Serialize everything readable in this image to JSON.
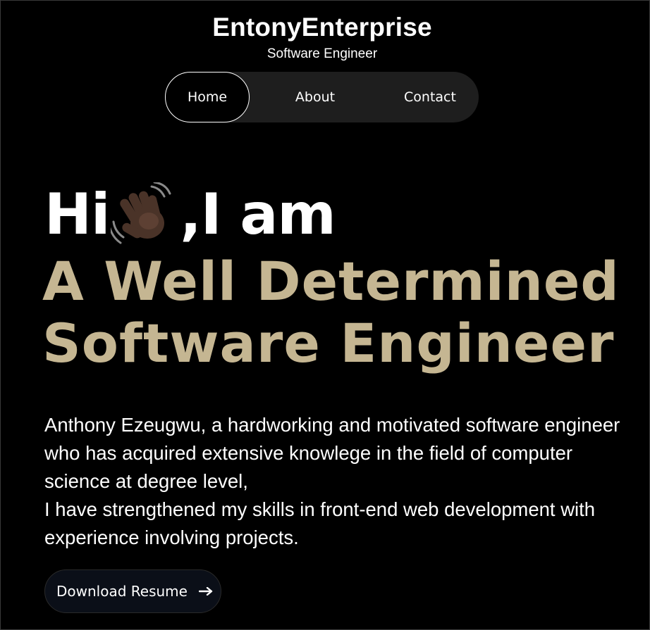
{
  "header": {
    "brand": "EntonyEnterprise",
    "subtitle": "Software Engineer"
  },
  "nav": {
    "items": [
      {
        "label": "Home",
        "active": true
      },
      {
        "label": "About",
        "active": false
      },
      {
        "label": "Contact",
        "active": false
      }
    ]
  },
  "hero": {
    "greeting_before": "Hi",
    "greeting_icon": "waving-hand-icon",
    "greeting_after": ",I am",
    "title_line_1": "A Well Determined",
    "title_line_2": "Software Engineer"
  },
  "bio": {
    "paragraph_1": "Anthony Ezeugwu, a hardworking and motivated software engineer who has acquired extensive knowlege in the field of computer science at degree level,",
    "paragraph_2": "I have strengthened my skills in front-end web development with experience involving projects."
  },
  "cta": {
    "download_label": "Download Resume",
    "icon": "arrow-right-icon"
  },
  "colors": {
    "background": "#000000",
    "accent": "#c5b692",
    "nav_bg": "#1e1e1e",
    "button_bg": "#0b0f18"
  }
}
